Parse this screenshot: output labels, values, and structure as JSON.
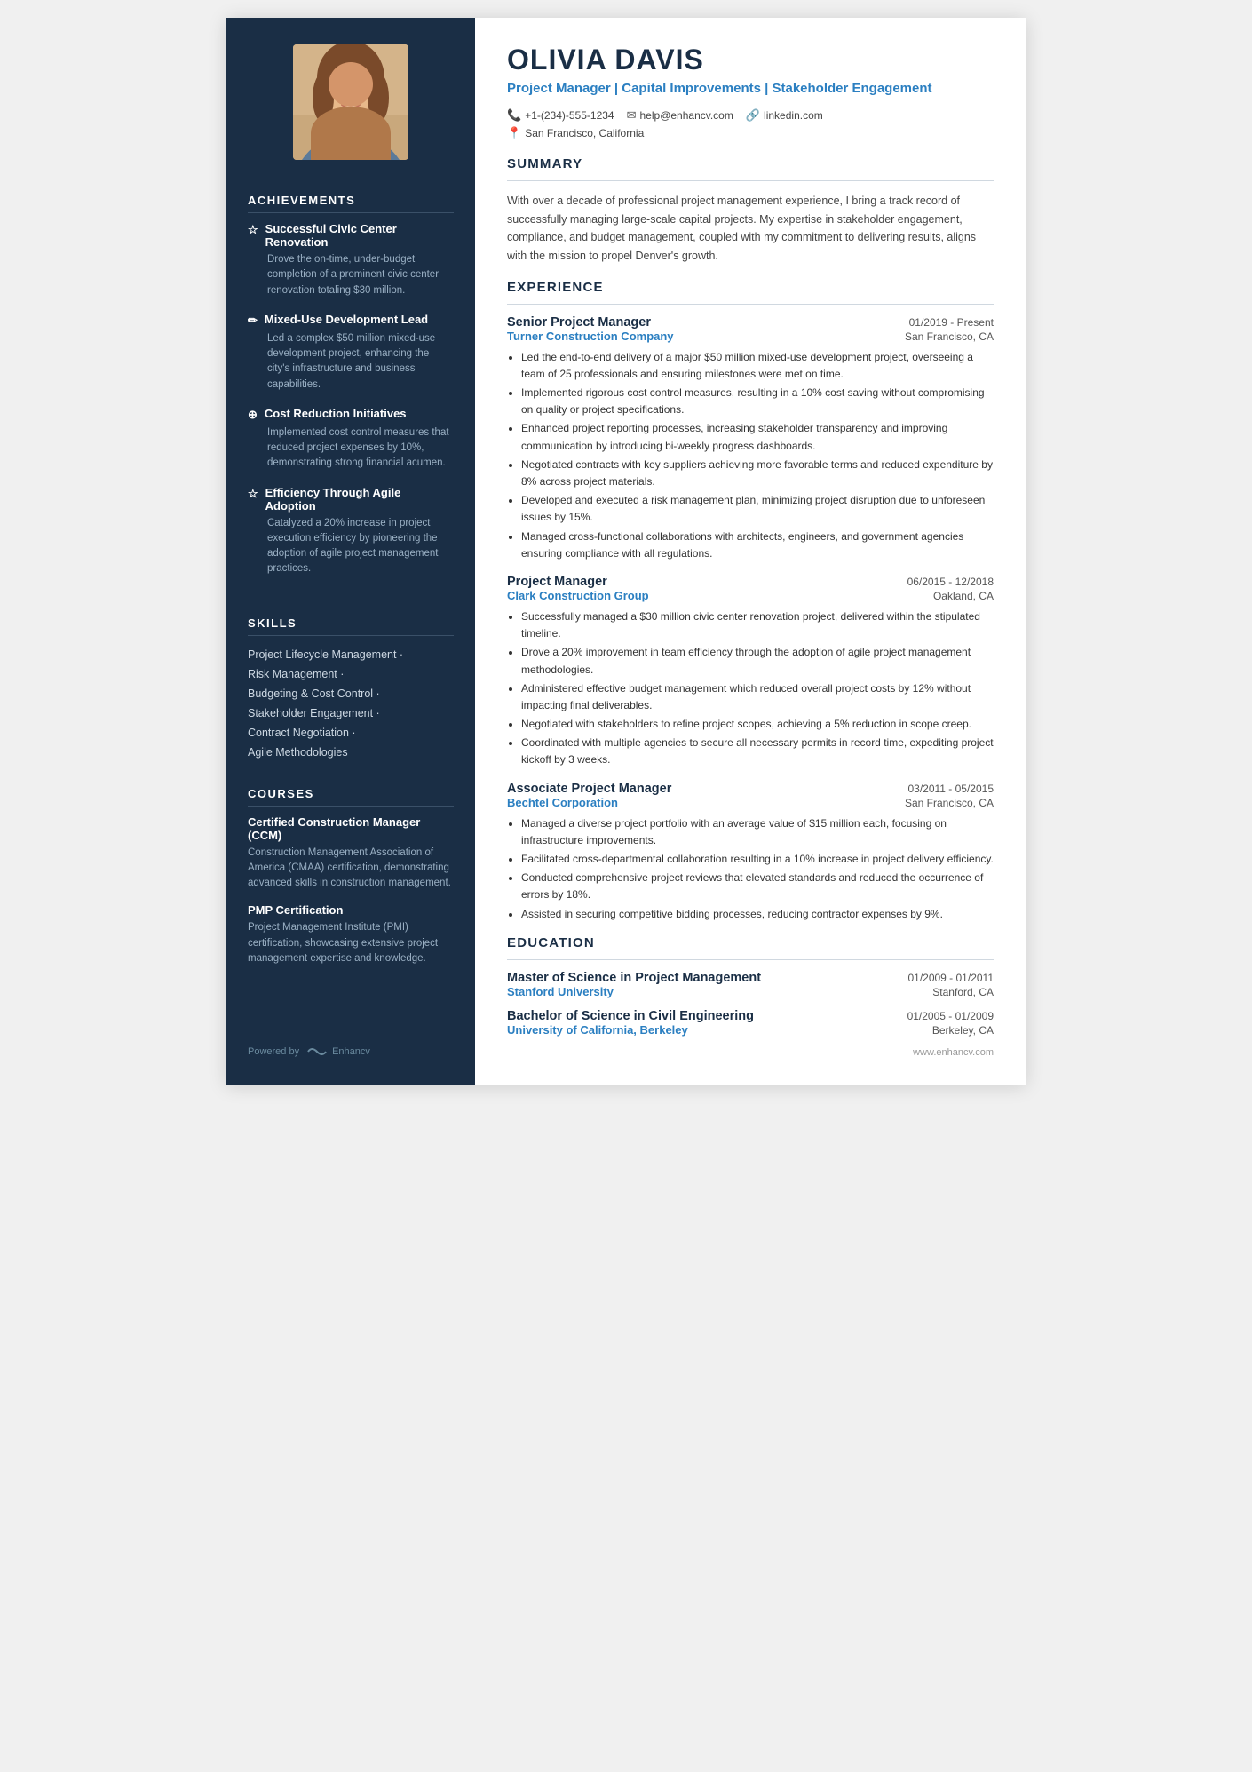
{
  "sidebar": {
    "achievements_title": "ACHIEVEMENTS",
    "achievements": [
      {
        "icon": "☆",
        "title": "Successful Civic Center Renovation",
        "desc": "Drove the on-time, under-budget completion of a prominent civic center renovation totaling $30 million."
      },
      {
        "icon": "✏",
        "title": "Mixed-Use Development Lead",
        "desc": "Led a complex $50 million mixed-use development project, enhancing the city's infrastructure and business capabilities."
      },
      {
        "icon": "⊕",
        "title": "Cost Reduction Initiatives",
        "desc": "Implemented cost control measures that reduced project expenses by 10%, demonstrating strong financial acumen."
      },
      {
        "icon": "☆",
        "title": "Efficiency Through Agile Adoption",
        "desc": "Catalyzed a 20% increase in project execution efficiency by pioneering the adoption of agile project management practices."
      }
    ],
    "skills_title": "SKILLS",
    "skills": [
      "Project Lifecycle Management ·",
      "Risk Management ·",
      "Budgeting & Cost Control ·",
      "Stakeholder Engagement ·",
      "Contract Negotiation ·",
      "Agile Methodologies"
    ],
    "courses_title": "COURSES",
    "courses": [
      {
        "title": "Certified Construction Manager (CCM)",
        "desc": "Construction Management Association of America (CMAA) certification, demonstrating advanced skills in construction management."
      },
      {
        "title": "PMP Certification",
        "desc": "Project Management Institute (PMI) certification, showcasing extensive project management expertise and knowledge."
      }
    ],
    "footer_label": "Powered by",
    "footer_brand": "Enhancv"
  },
  "header": {
    "name": "OLIVIA DAVIS",
    "title": "Project Manager | Capital Improvements | Stakeholder Engagement",
    "phone": "+1-(234)-555-1234",
    "email": "help@enhancv.com",
    "linkedin": "linkedin.com",
    "location": "San Francisco, California"
  },
  "summary": {
    "section_title": "SUMMARY",
    "text": "With over a decade of professional project management experience, I bring a track record of successfully managing large-scale capital projects. My expertise in stakeholder engagement, compliance, and budget management, coupled with my commitment to delivering results, aligns with the mission to propel Denver's growth."
  },
  "experience": {
    "section_title": "EXPERIENCE",
    "jobs": [
      {
        "title": "Senior Project Manager",
        "date": "01/2019 - Present",
        "company": "Turner Construction Company",
        "location": "San Francisco, CA",
        "bullets": [
          "Led the end-to-end delivery of a major $50 million mixed-use development project, overseeing a team of 25 professionals and ensuring milestones were met on time.",
          "Implemented rigorous cost control measures, resulting in a 10% cost saving without compromising on quality or project specifications.",
          "Enhanced project reporting processes, increasing stakeholder transparency and improving communication by introducing bi-weekly progress dashboards.",
          "Negotiated contracts with key suppliers achieving more favorable terms and reduced expenditure by 8% across project materials.",
          "Developed and executed a risk management plan, minimizing project disruption due to unforeseen issues by 15%.",
          "Managed cross-functional collaborations with architects, engineers, and government agencies ensuring compliance with all regulations."
        ]
      },
      {
        "title": "Project Manager",
        "date": "06/2015 - 12/2018",
        "company": "Clark Construction Group",
        "location": "Oakland, CA",
        "bullets": [
          "Successfully managed a $30 million civic center renovation project, delivered within the stipulated timeline.",
          "Drove a 20% improvement in team efficiency through the adoption of agile project management methodologies.",
          "Administered effective budget management which reduced overall project costs by 12% without impacting final deliverables.",
          "Negotiated with stakeholders to refine project scopes, achieving a 5% reduction in scope creep.",
          "Coordinated with multiple agencies to secure all necessary permits in record time, expediting project kickoff by 3 weeks."
        ]
      },
      {
        "title": "Associate Project Manager",
        "date": "03/2011 - 05/2015",
        "company": "Bechtel Corporation",
        "location": "San Francisco, CA",
        "bullets": [
          "Managed a diverse project portfolio with an average value of $15 million each, focusing on infrastructure improvements.",
          "Facilitated cross-departmental collaboration resulting in a 10% increase in project delivery efficiency.",
          "Conducted comprehensive project reviews that elevated standards and reduced the occurrence of errors by 18%.",
          "Assisted in securing competitive bidding processes, reducing contractor expenses by 9%."
        ]
      }
    ]
  },
  "education": {
    "section_title": "EDUCATION",
    "entries": [
      {
        "degree": "Master of Science in Project Management",
        "date": "01/2009 - 01/2011",
        "school": "Stanford University",
        "location": "Stanford, CA"
      },
      {
        "degree": "Bachelor of Science in Civil Engineering",
        "date": "01/2005 - 01/2009",
        "school": "University of California, Berkeley",
        "location": "Berkeley, CA"
      }
    ]
  },
  "footer": {
    "website": "www.enhancv.com"
  }
}
